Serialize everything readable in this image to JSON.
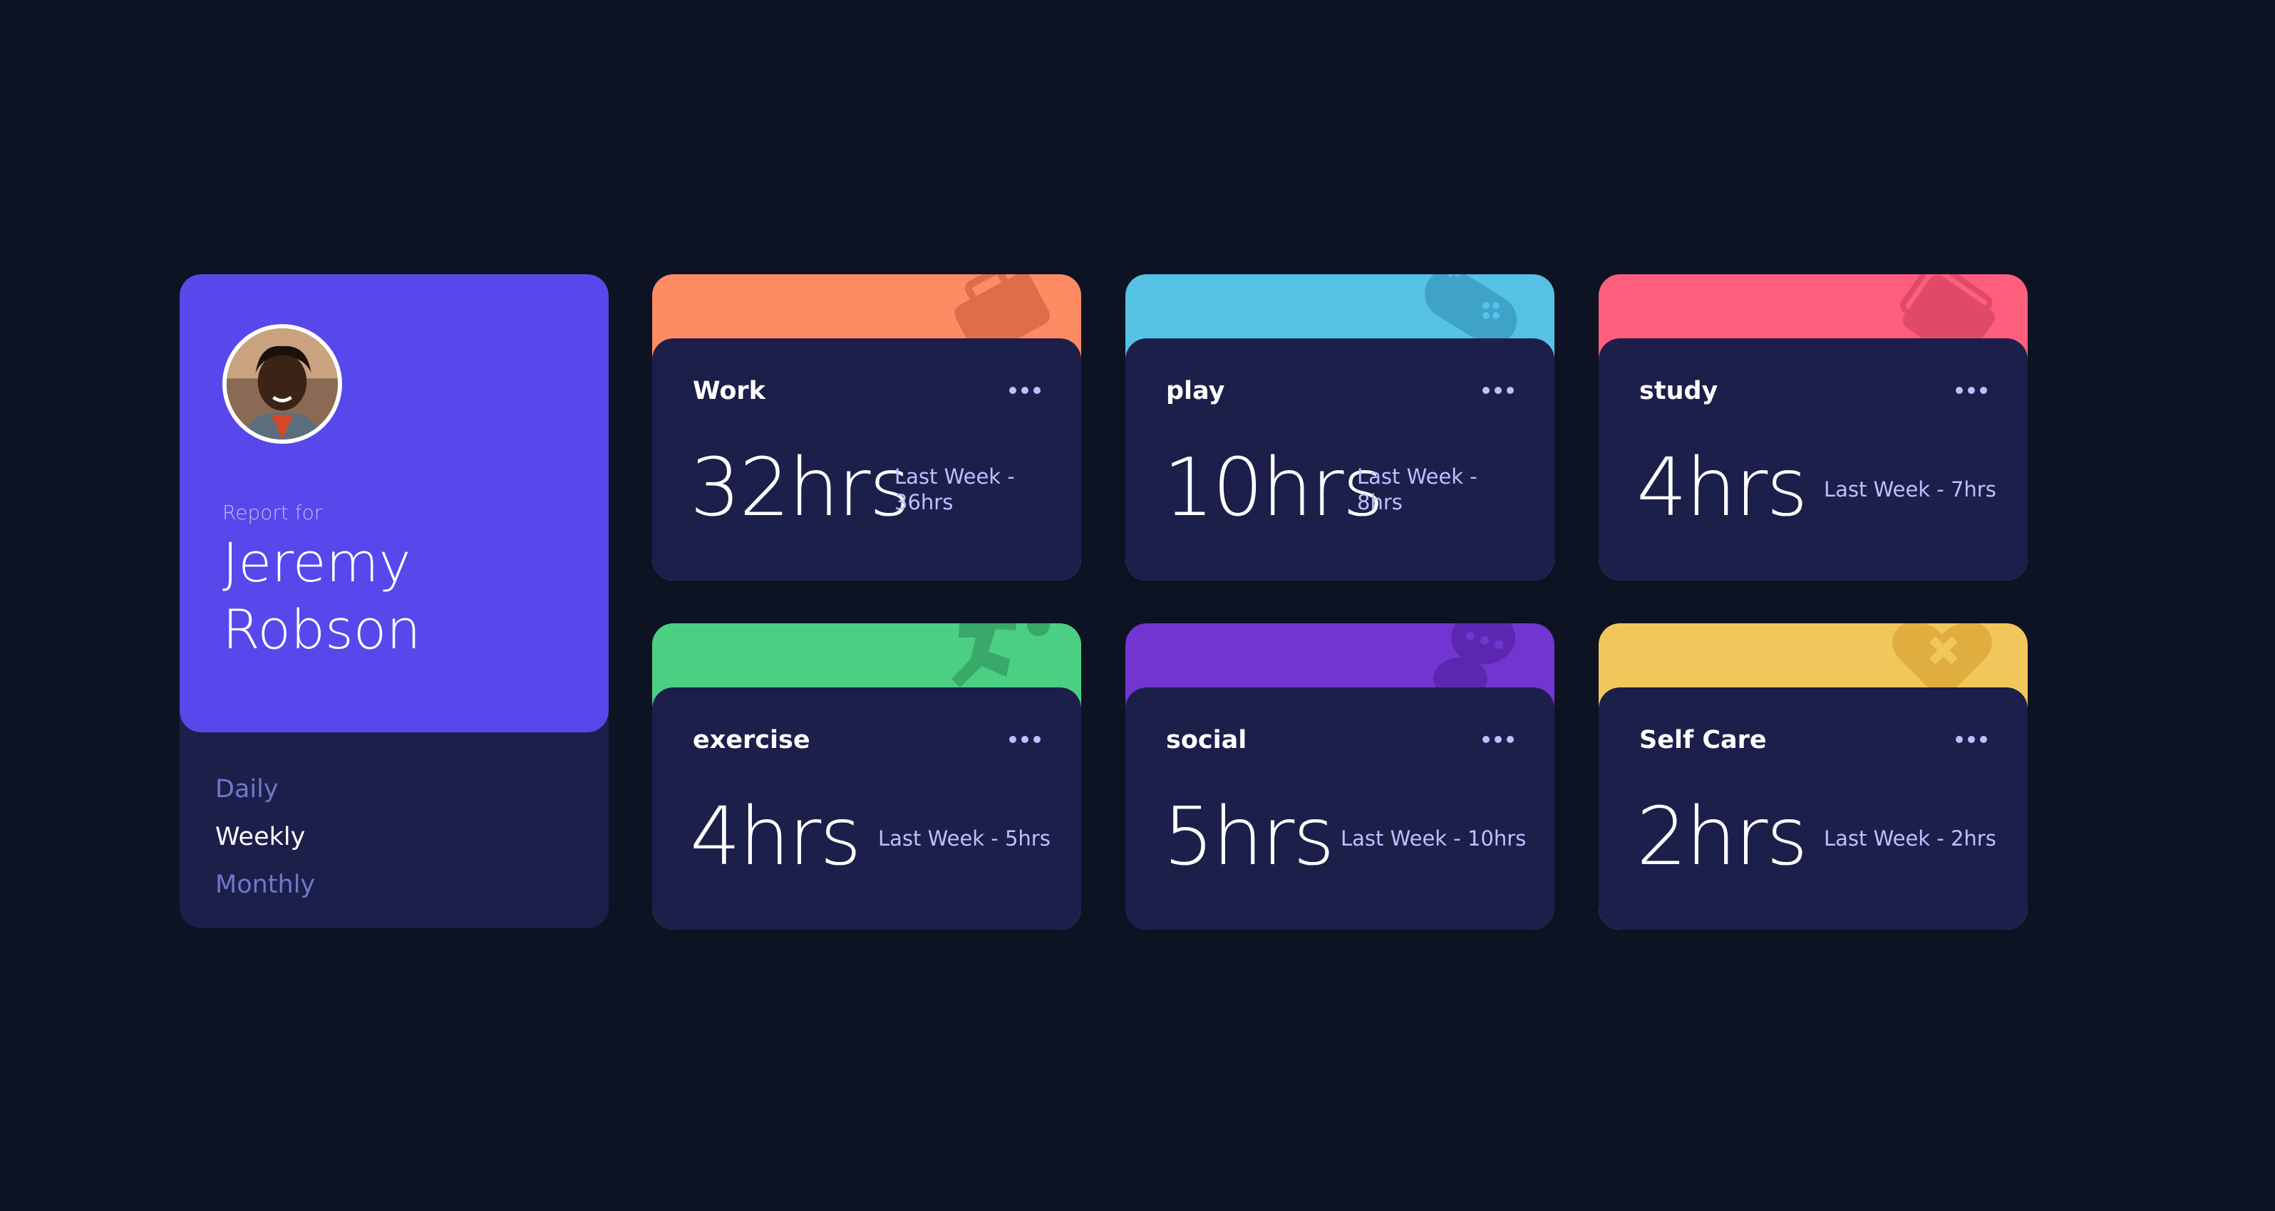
{
  "profile": {
    "report_for": "Report for",
    "name": "Jeremy Robson",
    "periods": [
      "Daily",
      "Weekly",
      "Monthly"
    ],
    "active_period": "Weekly",
    "accent_color": "#5847eb"
  },
  "activities": [
    {
      "title": "Work",
      "hours": "32hrs",
      "last_week": "Last Week - 36hrs",
      "color": "#ff8b64",
      "icon": "briefcase-icon"
    },
    {
      "title": "play",
      "hours": "10hrs",
      "last_week": "Last Week - 8hrs",
      "color": "#55c2e6",
      "icon": "gamepad-icon"
    },
    {
      "title": "study",
      "hours": "4hrs",
      "last_week": "Last Week - 7hrs",
      "color": "#ff5e7d",
      "icon": "books-icon"
    },
    {
      "title": "exercise",
      "hours": "4hrs",
      "last_week": "Last Week - 5hrs",
      "color": "#4bcf82",
      "icon": "running-icon"
    },
    {
      "title": "social",
      "hours": "5hrs",
      "last_week": "Last Week - 10hrs",
      "color": "#7335d2",
      "icon": "chat-icon"
    },
    {
      "title": "Self Care",
      "hours": "2hrs",
      "last_week": "Last Week - 2hrs",
      "color": "#f1c75b",
      "icon": "heart-icon"
    }
  ]
}
